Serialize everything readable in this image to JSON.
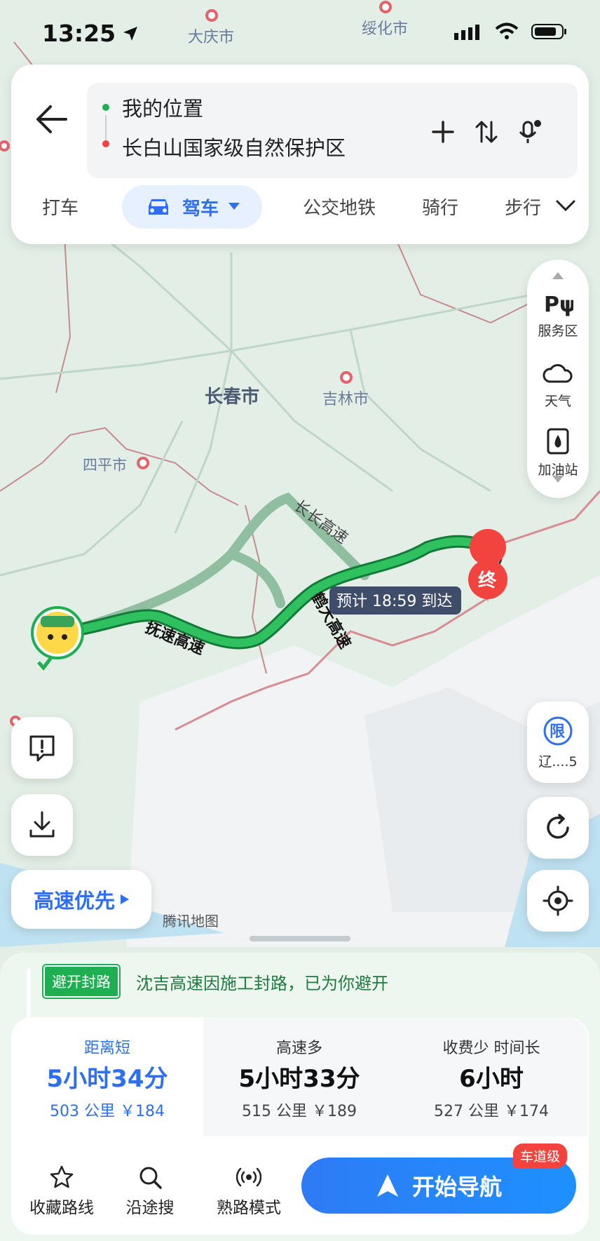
{
  "status_bar": {
    "time": "13:25"
  },
  "search": {
    "origin": "我的位置",
    "destination": "长白山国家级自然保护区"
  },
  "travel_modes": {
    "taxi": "打车",
    "drive": "驾车",
    "transit": "公交地铁",
    "bike": "骑行",
    "walk": "步行"
  },
  "map": {
    "cities": {
      "daqing": "大庆市",
      "suihua": "绥化市",
      "changchun": "长春市",
      "jilin": "吉林市",
      "siping": "四平市"
    },
    "roads": {
      "fusu": "抚速高速",
      "hedagao": "鹤大高速",
      "changchang": "长长高速"
    },
    "eta": "预计 18:59 到达",
    "end_marker": "终",
    "attribution": "腾讯地图"
  },
  "side_tools": {
    "service_area": "服务区",
    "weather": "天气",
    "gas": "加油站"
  },
  "restriction": {
    "icon_char": "限",
    "label": "辽....5"
  },
  "route_preference": "高速优先",
  "notice": {
    "badge": "避开封路",
    "text": "沈吉高速因施工封路，已为你避开"
  },
  "route_options": [
    {
      "tag": "距离短",
      "time": "5小时34分",
      "info": "503 公里  ￥184"
    },
    {
      "tag": "高速多",
      "time": "5小时33分",
      "info": "515 公里  ￥189"
    },
    {
      "tag": "收费少 时间长",
      "time": "6小时",
      "info": "527 公里  ￥174"
    }
  ],
  "actions": {
    "favorite": "收藏路线",
    "along_search": "沿途搜",
    "familiar_mode": "熟路模式"
  },
  "navigation": {
    "start_label": "开始导航",
    "lane_badge": "车道级"
  },
  "colors": {
    "accent": "#2e6ff2",
    "route_green": "#1fae52",
    "destination_red": "#f2433f"
  }
}
